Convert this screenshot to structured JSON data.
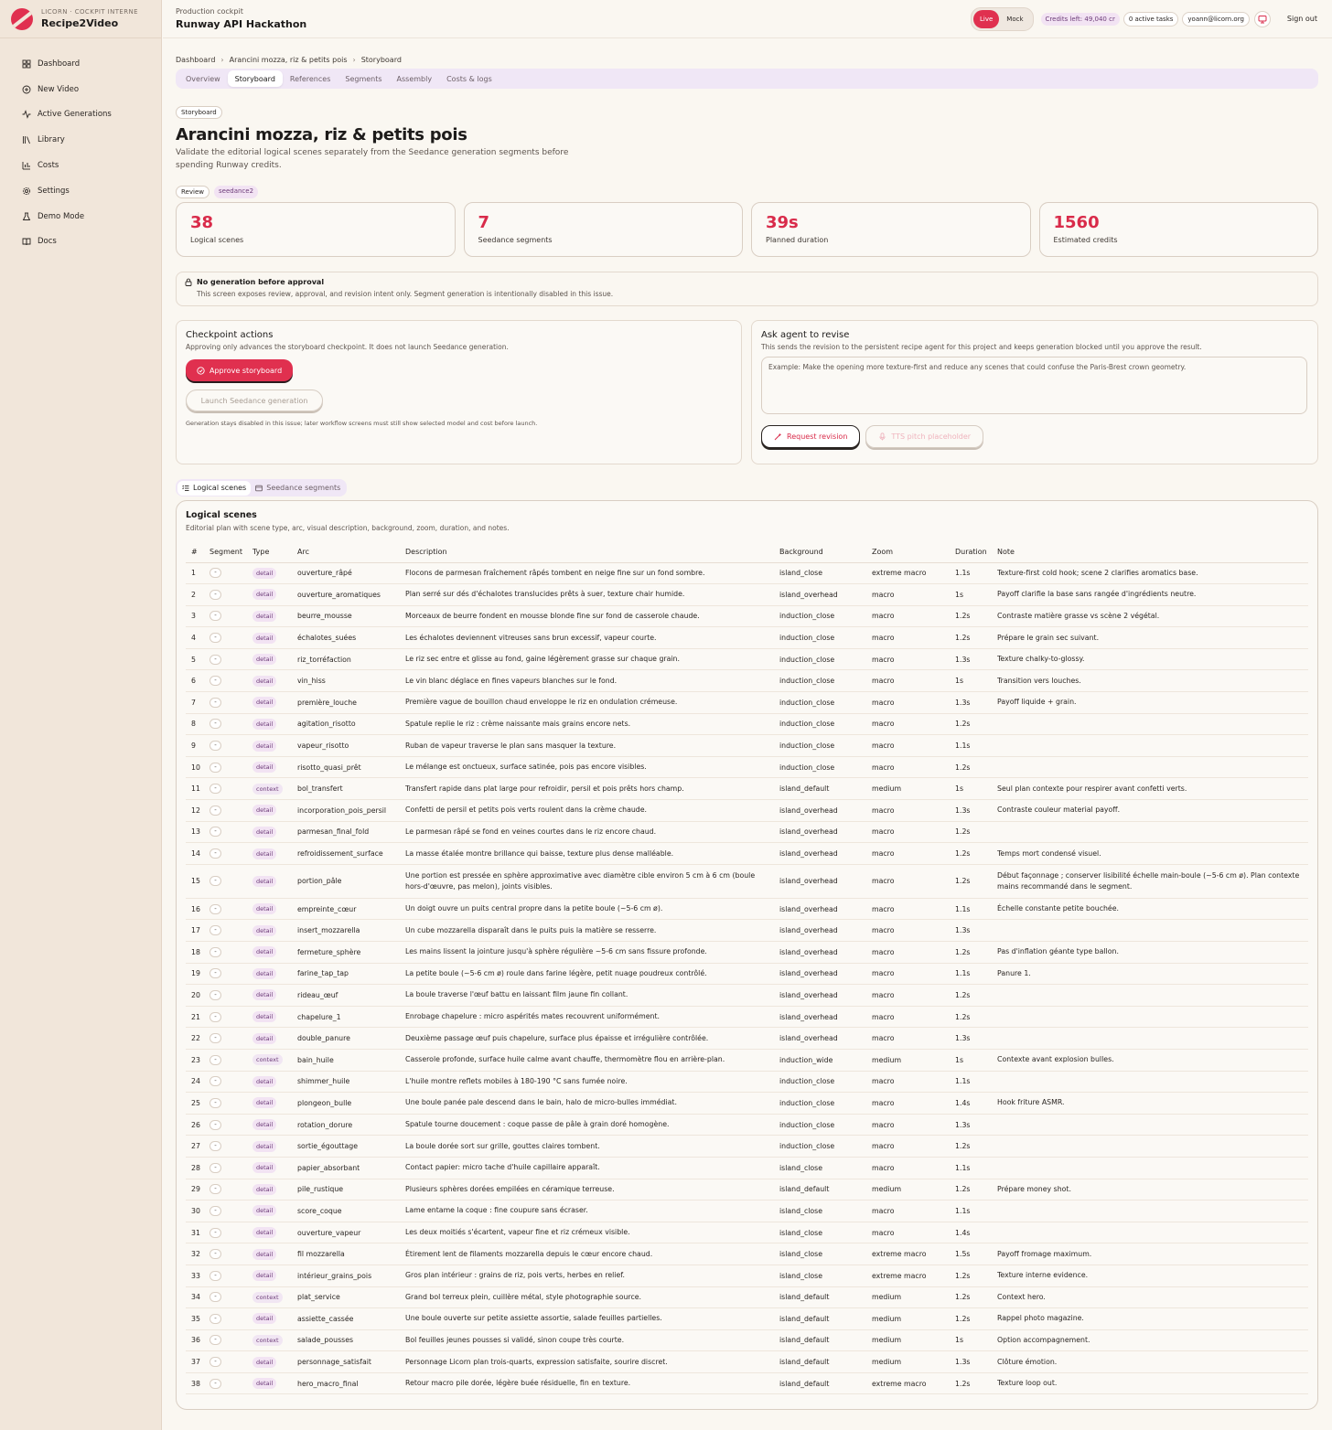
{
  "brand": {
    "sub": "LICORN · COCKPIT INTERNE",
    "name": "Recipe2Video"
  },
  "nav": [
    {
      "label": "Dashboard",
      "icon": "grid-icon"
    },
    {
      "label": "New Video",
      "icon": "plus-circle-icon"
    },
    {
      "label": "Active Generations",
      "icon": "activity-icon"
    },
    {
      "label": "Library",
      "icon": "library-icon"
    },
    {
      "label": "Costs",
      "icon": "bar-chart-icon"
    },
    {
      "label": "Settings",
      "icon": "gear-icon"
    },
    {
      "label": "Demo Mode",
      "icon": "flask-icon"
    },
    {
      "label": "Docs",
      "icon": "book-icon"
    }
  ],
  "topbar": {
    "subtitle": "Production cockpit",
    "title": "Runway API Hackathon",
    "live": "Live",
    "mock": "Mock",
    "credits": "Credits left: 49,040 cr",
    "tasks": "0 active tasks",
    "user": "yoann@licorn.org",
    "signout": "Sign out"
  },
  "breadcrumb": [
    "Dashboard",
    "Arancini mozza, riz & petits pois",
    "Storyboard"
  ],
  "tabs": [
    "Overview",
    "Storyboard",
    "References",
    "Segments",
    "Assembly",
    "Costs & logs"
  ],
  "page": {
    "tag": "Storyboard",
    "title": "Arancini mozza, riz & petits pois",
    "lead": "Validate the editorial logical scenes separately from the Seedance generation segments before spending Runway credits.",
    "tags": [
      "Review",
      "seedance2"
    ]
  },
  "stats": [
    {
      "value": "38",
      "label": "Logical scenes"
    },
    {
      "value": "7",
      "label": "Seedance segments"
    },
    {
      "value": "39s",
      "label": "Planned duration"
    },
    {
      "value": "1560",
      "label": "Estimated credits"
    }
  ],
  "notice": {
    "title": "No generation before approval",
    "body": "This screen exposes review, approval, and revision intent only. Segment generation is intentionally disabled in this issue."
  },
  "checkpoint": {
    "title": "Checkpoint actions",
    "sub": "Approving only advances the storyboard checkpoint. It does not launch Seedance generation.",
    "approve": "Approve storyboard",
    "launch": "Launch Seedance generation",
    "note": "Generation stays disabled in this issue; later workflow screens must still show selected model and cost before launch."
  },
  "revise": {
    "title": "Ask agent to revise",
    "sub": "This sends the revision to the persistent recipe agent for this project and keeps generation blocked until you approve the result.",
    "placeholder": "Example: Make the opening more texture-first and reduce any scenes that could confuse the Paris-Brest crown geometry.",
    "request": "Request revision",
    "tts": "TTS pitch placeholder"
  },
  "subtabs": [
    "Logical scenes",
    "Seedance segments"
  ],
  "table": {
    "title": "Logical scenes",
    "sub": "Editorial plan with scene type, arc, visual description, background, zoom, duration, and notes.",
    "headers": [
      "#",
      "Segment",
      "Type",
      "Arc",
      "Description",
      "Background",
      "Zoom",
      "Duration",
      "Note"
    ],
    "rows": [
      [
        "1",
        "-",
        "detail",
        "ouverture_râpé",
        "Flocons de parmesan fraîchement râpés tombent en neige fine sur un fond sombre.",
        "island_close",
        "extreme macro",
        "1.1s",
        "Texture-first cold hook; scene 2 clarifies aromatics base."
      ],
      [
        "2",
        "-",
        "detail",
        "ouverture_aromatiques",
        "Plan serré sur dés d'échalotes translucides prêts à suer, texture chair humide.",
        "island_overhead",
        "macro",
        "1s",
        "Payoff clarifie la base sans rangée d'ingrédients neutre."
      ],
      [
        "3",
        "-",
        "detail",
        "beurre_mousse",
        "Morceaux de beurre fondent en mousse blonde fine sur fond de casserole chaude.",
        "induction_close",
        "macro",
        "1.2s",
        "Contraste matière grasse vs scène 2 végétal."
      ],
      [
        "4",
        "-",
        "detail",
        "échalotes_suées",
        "Les échalotes deviennent vitreuses sans brun excessif, vapeur courte.",
        "induction_close",
        "macro",
        "1.2s",
        "Prépare le grain sec suivant."
      ],
      [
        "5",
        "-",
        "detail",
        "riz_torréfaction",
        "Le riz sec entre et glisse au fond, gaine légèrement grasse sur chaque grain.",
        "induction_close",
        "macro",
        "1.3s",
        "Texture chalky-to-glossy."
      ],
      [
        "6",
        "-",
        "detail",
        "vin_hiss",
        "Le vin blanc déglace en fines vapeurs blanches sur le fond.",
        "induction_close",
        "macro",
        "1s",
        "Transition vers louches."
      ],
      [
        "7",
        "-",
        "detail",
        "première_louche",
        "Première vague de bouillon chaud enveloppe le riz en ondulation crémeuse.",
        "induction_close",
        "macro",
        "1.3s",
        "Payoff liquide + grain."
      ],
      [
        "8",
        "-",
        "detail",
        "agitation_risotto",
        "Spatule replie le riz : crème naissante mais grains encore nets.",
        "induction_close",
        "macro",
        "1.2s",
        ""
      ],
      [
        "9",
        "-",
        "detail",
        "vapeur_risotto",
        "Ruban de vapeur traverse le plan sans masquer la texture.",
        "induction_close",
        "macro",
        "1.1s",
        ""
      ],
      [
        "10",
        "-",
        "detail",
        "risotto_quasi_prêt",
        "Le mélange est onctueux, surface satinée, pois pas encore visibles.",
        "induction_close",
        "macro",
        "1.2s",
        ""
      ],
      [
        "11",
        "-",
        "context",
        "bol_transfert",
        "Transfert rapide dans plat large pour refroidir, persil et pois prêts hors champ.",
        "island_default",
        "medium",
        "1s",
        "Seul plan contexte pour respirer avant confetti verts."
      ],
      [
        "12",
        "-",
        "detail",
        "incorporation_pois_persil",
        "Confetti de persil et petits pois verts roulent dans la crème chaude.",
        "island_overhead",
        "macro",
        "1.3s",
        "Contraste couleur material payoff."
      ],
      [
        "13",
        "-",
        "detail",
        "parmesan_final_fold",
        "Le parmesan râpé se fond en veines courtes dans le riz encore chaud.",
        "island_overhead",
        "macro",
        "1.2s",
        ""
      ],
      [
        "14",
        "-",
        "detail",
        "refroidissement_surface",
        "La masse étalée montre brillance qui baisse, texture plus dense malléable.",
        "island_overhead",
        "macro",
        "1.2s",
        "Temps mort condensé visuel."
      ],
      [
        "15",
        "-",
        "detail",
        "portion_pâle",
        "Une portion est pressée en sphère approximative avec diamètre cible environ 5 cm à 6 cm (boule hors-d'œuvre, pas melon), joints visibles.",
        "island_overhead",
        "macro",
        "1.2s",
        "Début façonnage ; conserver lisibilité échelle main-boule (~5-6 cm ø). Plan contexte mains recommandé dans le segment."
      ],
      [
        "16",
        "-",
        "detail",
        "empreinte_cœur",
        "Un doigt ouvre un puits central propre dans la petite boule (~5-6 cm ø).",
        "island_overhead",
        "macro",
        "1.1s",
        "Échelle constante petite bouchée."
      ],
      [
        "17",
        "-",
        "detail",
        "insert_mozzarella",
        "Un cube mozzarella disparaît dans le puits puis la matière se resserre.",
        "island_overhead",
        "macro",
        "1.3s",
        ""
      ],
      [
        "18",
        "-",
        "detail",
        "fermeture_sphère",
        "Les mains lissent la jointure jusqu'à sphère régulière ~5-6 cm sans fissure profonde.",
        "island_overhead",
        "macro",
        "1.2s",
        "Pas d'inflation géante type ballon."
      ],
      [
        "19",
        "-",
        "detail",
        "farine_tap_tap",
        "La petite boule (~5-6 cm ø) roule dans farine légère, petit nuage poudreux contrôlé.",
        "island_overhead",
        "macro",
        "1.1s",
        "Panure 1."
      ],
      [
        "20",
        "-",
        "detail",
        "rideau_œuf",
        "La boule traverse l'œuf battu en laissant film jaune fin collant.",
        "island_overhead",
        "macro",
        "1.2s",
        ""
      ],
      [
        "21",
        "-",
        "detail",
        "chapelure_1",
        "Enrobage chapelure : micro aspérités mates recouvrent uniformément.",
        "island_overhead",
        "macro",
        "1.2s",
        ""
      ],
      [
        "22",
        "-",
        "detail",
        "double_panure",
        "Deuxième passage œuf puis chapelure, surface plus épaisse et irrégulière contrôlée.",
        "island_overhead",
        "macro",
        "1.3s",
        ""
      ],
      [
        "23",
        "-",
        "context",
        "bain_huile",
        "Casserole profonde, surface huile calme avant chauffe, thermomètre flou en arrière-plan.",
        "induction_wide",
        "medium",
        "1s",
        "Contexte avant explosion bulles."
      ],
      [
        "24",
        "-",
        "detail",
        "shimmer_huile",
        "L'huile montre reflets mobiles à 180-190 °C sans fumée noire.",
        "induction_close",
        "macro",
        "1.1s",
        ""
      ],
      [
        "25",
        "-",
        "detail",
        "plongeon_bulle",
        "Une boule panée pale descend dans le bain, halo de micro-bulles immédiat.",
        "induction_close",
        "macro",
        "1.4s",
        "Hook friture ASMR."
      ],
      [
        "26",
        "-",
        "detail",
        "rotation_dorure",
        "Spatule tourne doucement : coque passe de pâle à grain doré homogène.",
        "induction_close",
        "macro",
        "1.3s",
        ""
      ],
      [
        "27",
        "-",
        "detail",
        "sortie_égouttage",
        "La boule dorée sort sur grille, gouttes claires tombent.",
        "induction_close",
        "macro",
        "1.2s",
        ""
      ],
      [
        "28",
        "-",
        "detail",
        "papier_absorbant",
        "Contact papier: micro tache d'huile capillaire apparaît.",
        "island_close",
        "macro",
        "1.1s",
        ""
      ],
      [
        "29",
        "-",
        "detail",
        "pile_rustique",
        "Plusieurs sphères dorées empilées en céramique terreuse.",
        "island_default",
        "medium",
        "1.2s",
        "Prépare money shot."
      ],
      [
        "30",
        "-",
        "detail",
        "score_coque",
        "Lame entame la coque : fine coupure sans écraser.",
        "island_close",
        "macro",
        "1.1s",
        ""
      ],
      [
        "31",
        "-",
        "detail",
        "ouverture_vapeur",
        "Les deux moitiés s'écartent, vapeur fine et riz crémeux visible.",
        "island_close",
        "macro",
        "1.4s",
        ""
      ],
      [
        "32",
        "-",
        "detail",
        "fil mozzarella",
        "Étirement lent de filaments mozzarella depuis le cœur encore chaud.",
        "island_close",
        "extreme macro",
        "1.5s",
        "Payoff fromage maximum."
      ],
      [
        "33",
        "-",
        "detail",
        "intérieur_grains_pois",
        "Gros plan intérieur : grains de riz, pois verts, herbes en relief.",
        "island_close",
        "extreme macro",
        "1.2s",
        "Texture interne evidence."
      ],
      [
        "34",
        "-",
        "context",
        "plat_service",
        "Grand bol terreux plein, cuillère métal, style photographie source.",
        "island_default",
        "medium",
        "1.2s",
        "Context hero."
      ],
      [
        "35",
        "-",
        "detail",
        "assiette_cassée",
        "Une boule ouverte sur petite assiette assortie, salade feuilles partielles.",
        "island_default",
        "medium",
        "1.2s",
        "Rappel photo magazine."
      ],
      [
        "36",
        "-",
        "context",
        "salade_pousses",
        "Bol feuilles jeunes pousses si validé, sinon coupe très courte.",
        "island_default",
        "medium",
        "1s",
        "Option accompagnement."
      ],
      [
        "37",
        "-",
        "detail",
        "personnage_satisfait",
        "Personnage Licorn plan trois-quarts, expression satisfaite, sourire discret.",
        "island_default",
        "medium",
        "1.3s",
        "Clôture émotion."
      ],
      [
        "38",
        "-",
        "detail",
        "hero_macro_final",
        "Retour macro pile dorée, légère buée résiduelle, fin en texture.",
        "island_default",
        "extreme macro",
        "1.2s",
        "Texture loop out."
      ]
    ]
  }
}
